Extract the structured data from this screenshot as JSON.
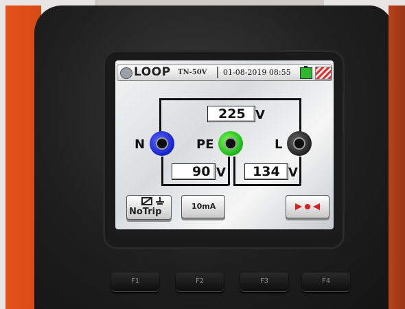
{
  "header": {
    "title": "LOOP",
    "mode": "TN-50V",
    "datetime": "01-08-2019 08:55"
  },
  "measurements": {
    "voltage_n_l": "225",
    "voltage_n_pe": "90",
    "voltage_pe_l": "134",
    "unit": "V"
  },
  "terminals": {
    "n": "N",
    "pe": "PE",
    "l": "L"
  },
  "buttons": {
    "notrip": "NoTrip",
    "current": "10mA"
  },
  "function_keys": [
    "F1",
    "F2",
    "F3",
    "F4"
  ],
  "colors": {
    "terminal_n": "#1420c8",
    "terminal_pe": "#18b418",
    "terminal_l": "#222222",
    "battery": "#2fb52f",
    "housing": "#e2531b"
  }
}
